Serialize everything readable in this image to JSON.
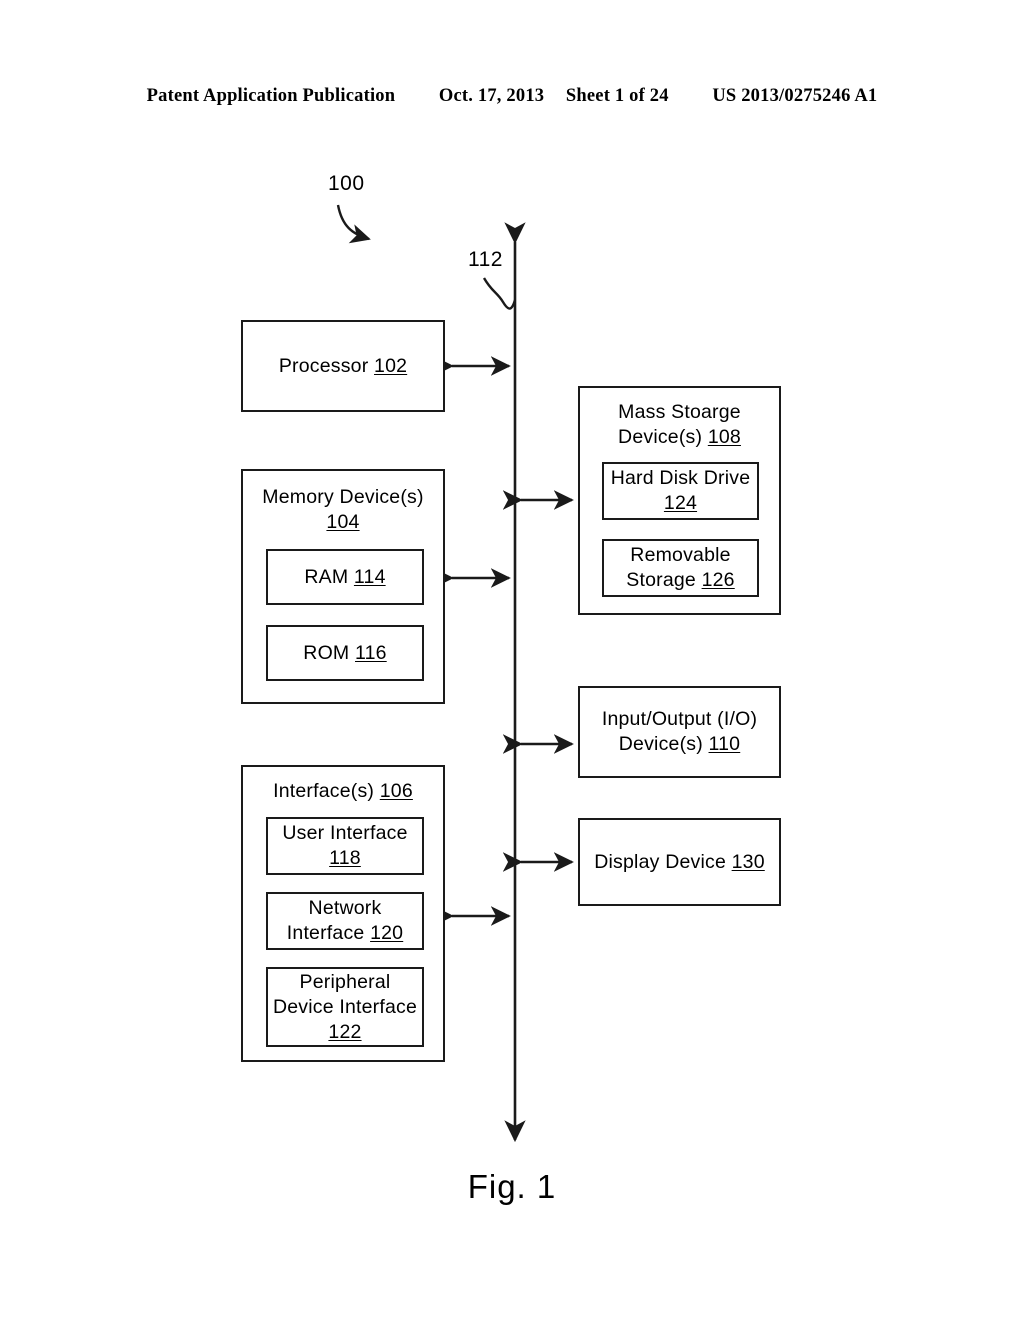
{
  "header": {
    "publication": "Patent Application Publication",
    "date": "Oct. 17, 2013",
    "sheet": "Sheet 1 of 24",
    "number": "US 2013/0275246 A1"
  },
  "figure": {
    "caption": "Fig. 1",
    "system_callout": "100",
    "bus_callout": "112"
  },
  "blocks": {
    "processor": {
      "label": "Processor ",
      "ref": "102"
    },
    "memory": {
      "label": "Memory Device(s)\n",
      "ref": "104",
      "children": [
        {
          "label": "RAM ",
          "ref": "114"
        },
        {
          "label": "ROM ",
          "ref": "116"
        }
      ]
    },
    "interfaces": {
      "label": "Interface(s) ",
      "ref": "106",
      "children": [
        {
          "label": "User Interface\n",
          "ref": "118"
        },
        {
          "label": "Network\nInterface ",
          "ref": "120"
        },
        {
          "label": "Peripheral\nDevice Interface\n",
          "ref": "122"
        }
      ]
    },
    "mass_storage": {
      "label": "Mass Stoarge\nDevice(s) ",
      "ref": "108",
      "children": [
        {
          "label": "Hard Disk Drive\n",
          "ref": "124"
        },
        {
          "label": "Removable\nStorage ",
          "ref": "126"
        }
      ]
    },
    "io": {
      "label": "Input/Output (I/O)\nDevice(s) ",
      "ref": "110"
    },
    "display": {
      "label": "Display Device ",
      "ref": "130"
    }
  },
  "colors": {
    "ink": "#1a1a1a",
    "paper": "#ffffff"
  }
}
